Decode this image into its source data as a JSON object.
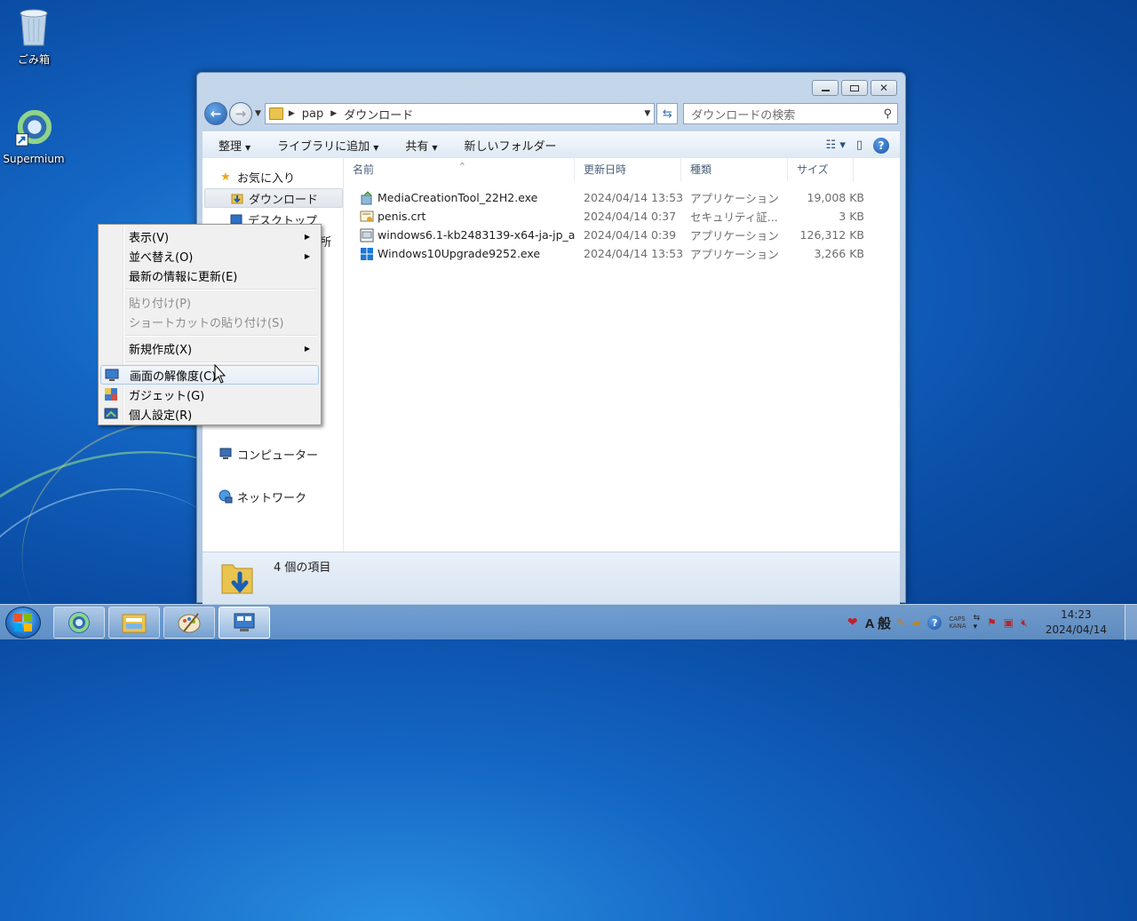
{
  "desktop": {
    "icons": [
      {
        "label": "ごみ箱"
      },
      {
        "label": "Supermium"
      }
    ]
  },
  "explorer": {
    "address": {
      "crumbs": [
        "pap",
        "ダウンロード"
      ]
    },
    "search_placeholder": "ダウンロードの検索",
    "toolbar": {
      "organize": "整理",
      "include_library": "ライブラリに追加",
      "share": "共有",
      "new_folder": "新しいフォルダー"
    },
    "nav": {
      "favorites": "お気に入り",
      "downloads": "ダウンロード",
      "desktop": "デスクトップ",
      "recent_partial": "所",
      "computer": "コンピューター",
      "network": "ネットワーク"
    },
    "columns": [
      "名前",
      "更新日時",
      "種類",
      "サイズ"
    ],
    "files": [
      {
        "name": "MediaCreationTool_22H2.exe",
        "date": "2024/04/14 13:53",
        "type": "アプリケーション",
        "size": "19,008 KB",
        "icon": "installer-icon"
      },
      {
        "name": "penis.crt",
        "date": "2024/04/14 0:37",
        "type": "セキュリティ証...",
        "size": "3 KB",
        "icon": "certificate-icon"
      },
      {
        "name": "windows6.1-kb2483139-x64-ja-jp_a...",
        "date": "2024/04/14 0:39",
        "type": "アプリケーション",
        "size": "126,312 KB",
        "icon": "update-package-icon"
      },
      {
        "name": "Windows10Upgrade9252.exe",
        "date": "2024/04/14 13:53",
        "type": "アプリケーション",
        "size": "3,266 KB",
        "icon": "windows-logo-icon"
      }
    ],
    "status": "4 個の項目"
  },
  "context_menu": {
    "items": [
      {
        "label": "表示(V)",
        "submenu": true,
        "enabled": true
      },
      {
        "label": "並べ替え(O)",
        "submenu": true,
        "enabled": true
      },
      {
        "label": "最新の情報に更新(E)",
        "submenu": false,
        "enabled": true
      },
      {
        "label": "貼り付け(P)",
        "submenu": false,
        "enabled": false
      },
      {
        "label": "ショートカットの貼り付け(S)",
        "submenu": false,
        "enabled": false
      },
      {
        "label": "新規作成(X)",
        "submenu": true,
        "enabled": true
      },
      {
        "label": "画面の解像度(C)",
        "submenu": false,
        "enabled": true,
        "highlighted": true,
        "icon": "display-icon"
      },
      {
        "label": "ガジェット(G)",
        "submenu": false,
        "enabled": true,
        "icon": "gadget-icon"
      },
      {
        "label": "個人設定(R)",
        "submenu": false,
        "enabled": true,
        "icon": "personalize-icon"
      }
    ]
  },
  "taskbar": {
    "ime_mode": "A",
    "ime_name": "般",
    "caps_label": "CAPS",
    "kana_label": "KANA",
    "clock_time": "14:23",
    "clock_date": "2024/04/14"
  },
  "colors": {
    "desktop_blue": "#1466c4",
    "window_frame": "#b3c8e0",
    "menu_highlight": "#a8c8ea"
  }
}
